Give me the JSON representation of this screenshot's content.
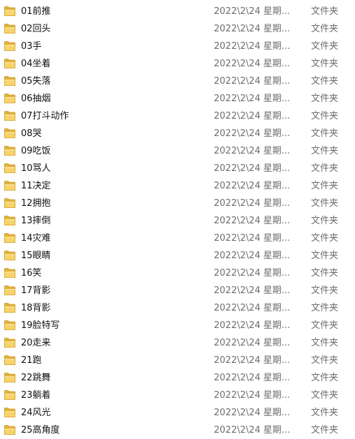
{
  "folders": [
    {
      "name": "01前推",
      "date": "2022\\2\\24 星期...",
      "type": "文件夹"
    },
    {
      "name": "02回头",
      "date": "2022\\2\\24 星期...",
      "type": "文件夹"
    },
    {
      "name": "03手",
      "date": "2022\\2\\24 星期...",
      "type": "文件夹"
    },
    {
      "name": "04坐着",
      "date": "2022\\2\\24 星期...",
      "type": "文件夹"
    },
    {
      "name": "05失落",
      "date": "2022\\2\\24 星期...",
      "type": "文件夹"
    },
    {
      "name": "06抽烟",
      "date": "2022\\2\\24 星期...",
      "type": "文件夹"
    },
    {
      "name": "07打斗动作",
      "date": "2022\\2\\24 星期...",
      "type": "文件夹"
    },
    {
      "name": "08哭",
      "date": "2022\\2\\24 星期...",
      "type": "文件夹"
    },
    {
      "name": "09吃饭",
      "date": "2022\\2\\24 星期...",
      "type": "文件夹"
    },
    {
      "name": "10骂人",
      "date": "2022\\2\\24 星期...",
      "type": "文件夹"
    },
    {
      "name": "11决定",
      "date": "2022\\2\\24 星期...",
      "type": "文件夹"
    },
    {
      "name": "12拥抱",
      "date": "2022\\2\\24 星期...",
      "type": "文件夹"
    },
    {
      "name": "13摔倒",
      "date": "2022\\2\\24 星期...",
      "type": "文件夹"
    },
    {
      "name": "14灾难",
      "date": "2022\\2\\24 星期...",
      "type": "文件夹"
    },
    {
      "name": "15眼睛",
      "date": "2022\\2\\24 星期...",
      "type": "文件夹"
    },
    {
      "name": "16笑",
      "date": "2022\\2\\24 星期...",
      "type": "文件夹"
    },
    {
      "name": "17背影",
      "date": "2022\\2\\24 星期...",
      "type": "文件夹"
    },
    {
      "name": "18背影",
      "date": "2022\\2\\24 星期...",
      "type": "文件夹"
    },
    {
      "name": "19脸特写",
      "date": "2022\\2\\24 星期...",
      "type": "文件夹"
    },
    {
      "name": "20走来",
      "date": "2022\\2\\24 星期...",
      "type": "文件夹"
    },
    {
      "name": "21跑",
      "date": "2022\\2\\24 星期...",
      "type": "文件夹"
    },
    {
      "name": "22跳舞",
      "date": "2022\\2\\24 星期...",
      "type": "文件夹"
    },
    {
      "name": "23躺着",
      "date": "2022\\2\\24 星期...",
      "type": "文件夹"
    },
    {
      "name": "24风光",
      "date": "2022\\2\\24 星期...",
      "type": "文件夹"
    },
    {
      "name": "25高角度",
      "date": "2022\\2\\24 星期...",
      "type": "文件夹"
    }
  ],
  "icon": "folder-icon",
  "colors": {
    "folder_body": "#e8bb3e",
    "folder_front": "#f6d46e",
    "secondary_text": "#6d6d6d"
  }
}
